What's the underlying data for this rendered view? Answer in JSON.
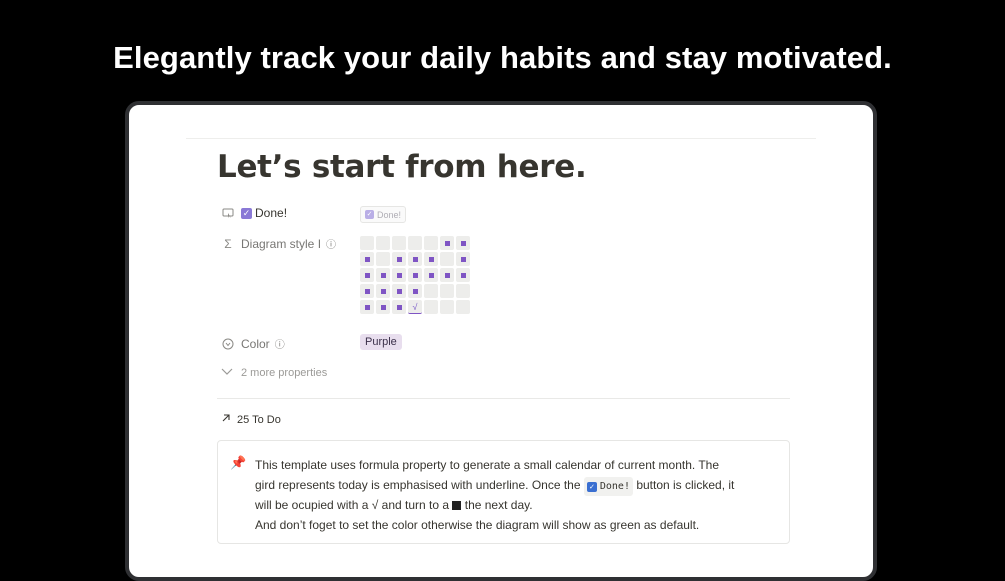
{
  "headline": "Elegantly track your daily habits and stay motivated.",
  "page": {
    "title": "Let’s start from here.",
    "properties": {
      "done_label": "Done!",
      "done_button_label": "Done!",
      "diagram_label": "Diagram style I",
      "color_label": "Color",
      "color_value": "Purple",
      "more_label": "2 more properties",
      "relation_label": "25 To Do"
    },
    "calendar": {
      "rows": [
        [
          0,
          0,
          0,
          0,
          0,
          1,
          1
        ],
        [
          1,
          0,
          1,
          1,
          1,
          0,
          1
        ],
        [
          1,
          1,
          1,
          1,
          1,
          1,
          1
        ],
        [
          1,
          1,
          1,
          1,
          0,
          0,
          0
        ],
        [
          1,
          1,
          1,
          2,
          0,
          0,
          0
        ]
      ],
      "today_mark": "√",
      "fill_color": "#7f55c4"
    },
    "callout": {
      "line1": "This template uses formula property to generate a small calendar of current month.  The",
      "line2_a": "gird represents today is emphasised with underline. Once the",
      "line2_code": "Done!",
      "line2_b": "button is clicked, it",
      "line3_a": "will be ocupied with a √ and turn to a",
      "line3_b": "the next day.",
      "line4": "And don’t foget to set the color otherwise the diagram will show as green as default."
    }
  },
  "colors": {
    "accent": "#8a79d6",
    "background": "#000000",
    "tag_bg": "#e8deee"
  }
}
